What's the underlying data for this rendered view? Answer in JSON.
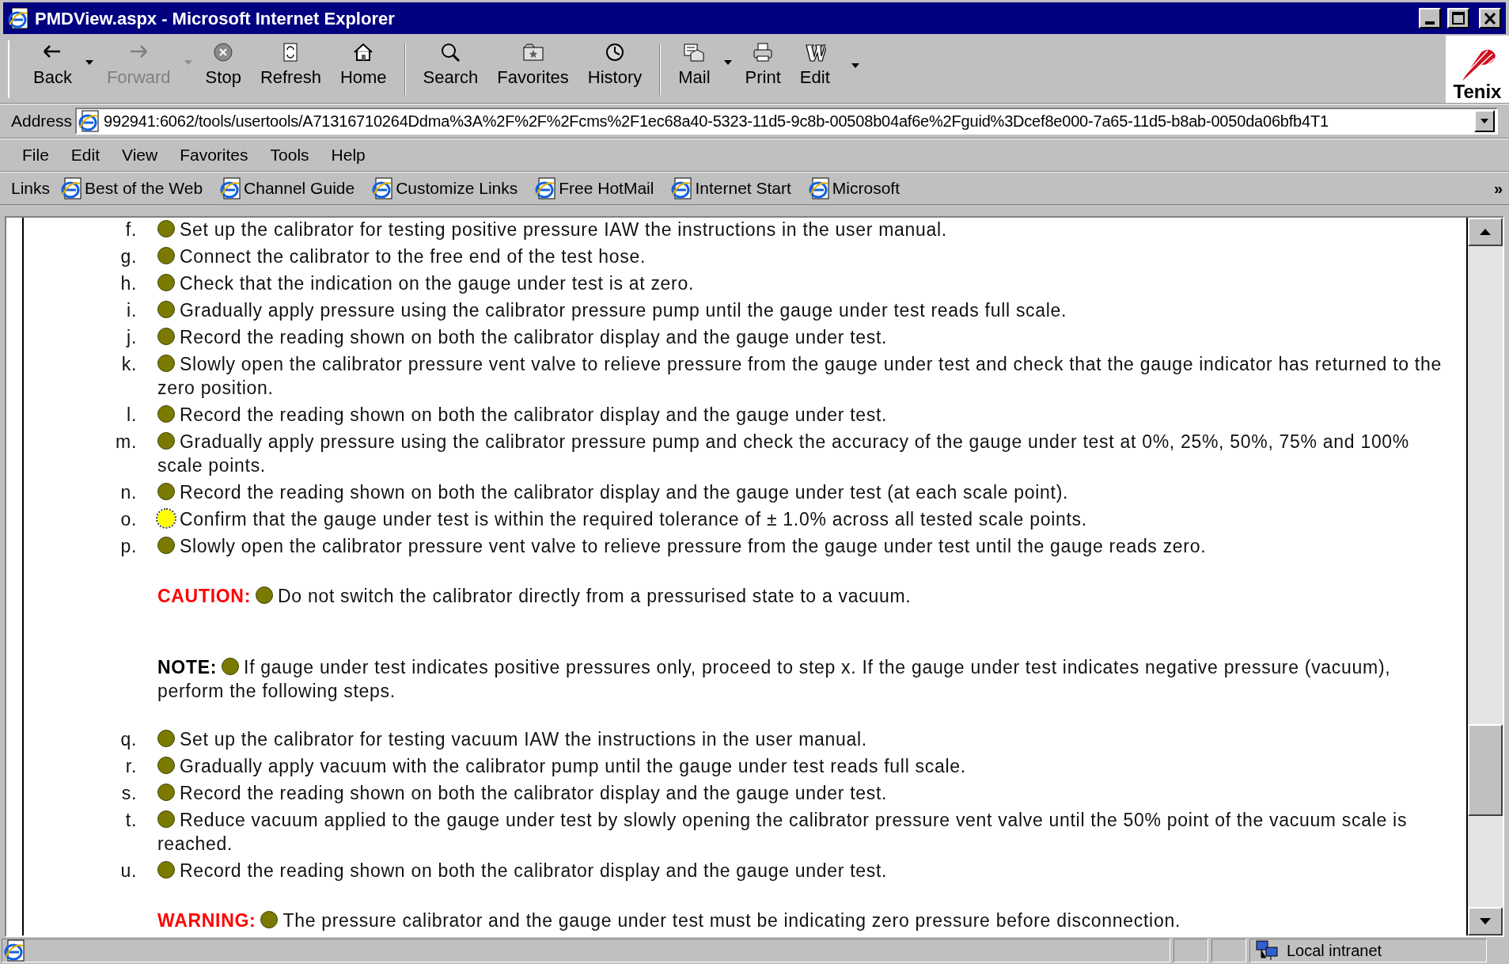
{
  "window": {
    "title": "PMDView.aspx - Microsoft Internet Explorer"
  },
  "toolbar": [
    {
      "kind": "back",
      "label": "Back",
      "disabled": false,
      "dropdown": true
    },
    {
      "kind": "forward",
      "label": "Forward",
      "disabled": true,
      "dropdown": true
    },
    {
      "kind": "stop",
      "label": "Stop",
      "disabled": false,
      "dropdown": false
    },
    {
      "kind": "refresh",
      "label": "Refresh",
      "disabled": false,
      "dropdown": false
    },
    {
      "kind": "home",
      "label": "Home",
      "disabled": false,
      "dropdown": false
    },
    {
      "kind": "separator"
    },
    {
      "kind": "search",
      "label": "Search",
      "disabled": false,
      "dropdown": false
    },
    {
      "kind": "favorites",
      "label": "Favorites",
      "disabled": false,
      "dropdown": false
    },
    {
      "kind": "history",
      "label": "History",
      "disabled": false,
      "dropdown": false
    },
    {
      "kind": "separator"
    },
    {
      "kind": "mail",
      "label": "Mail",
      "disabled": false,
      "dropdown": true
    },
    {
      "kind": "print",
      "label": "Print",
      "disabled": false,
      "dropdown": false
    },
    {
      "kind": "edit",
      "label": "Edit",
      "disabled": false,
      "dropdown": false
    },
    {
      "kind": "more"
    }
  ],
  "logo": {
    "text": "Tenix"
  },
  "address": {
    "label": "Address",
    "value": "992941:6062/tools/usertools/A71316710264Ddma%3A%2F%2F%2Fcms%2F1ec68a40-5323-11d5-9c8b-00508b04af6e%2Fguid%3Dcef8e000-7a65-11d5-b8ab-0050da06bfb4T1"
  },
  "menu": [
    "File",
    "Edit",
    "View",
    "Favorites",
    "Tools",
    "Help"
  ],
  "links": {
    "label": "Links",
    "items": [
      "Best of the Web",
      "Channel Guide",
      "Customize Links",
      "Free HotMail",
      "Internet Start",
      "Microsoft"
    ],
    "overflow": "»"
  },
  "content": [
    {
      "kind": "step",
      "label": "f.",
      "text": "Set up the calibrator for testing positive pressure IAW the instructions in the user manual.",
      "selected": false
    },
    {
      "kind": "step",
      "label": "g.",
      "text": "Connect the calibrator to the free end of the test hose.",
      "selected": false
    },
    {
      "kind": "step",
      "label": "h.",
      "text": "Check that the indication on the gauge under test is at zero.",
      "selected": false
    },
    {
      "kind": "step",
      "label": "i.",
      "text": "Gradually apply pressure using the calibrator pressure pump until the gauge under test reads full scale.",
      "selected": false
    },
    {
      "kind": "step",
      "label": "j.",
      "text": "Record the reading shown on both the calibrator display and the gauge under test.",
      "selected": false
    },
    {
      "kind": "step",
      "label": "k.",
      "text": "Slowly open the calibrator pressure vent valve to relieve pressure from the gauge under test and check that the gauge indicator has returned to the zero position.",
      "selected": false
    },
    {
      "kind": "step",
      "label": "l.",
      "text": "Record the reading shown on both the calibrator display and the gauge under test.",
      "selected": false
    },
    {
      "kind": "step",
      "label": "m.",
      "text": "Gradually apply pressure using the calibrator pressure pump and check the accuracy of the gauge under test at 0%, 25%, 50%, 75% and 100% scale points.",
      "selected": false
    },
    {
      "kind": "step",
      "label": "n.",
      "text": "Record the reading shown on both the calibrator display and the gauge under test (at each scale point).",
      "selected": false
    },
    {
      "kind": "step",
      "label": "o.",
      "text": "Confirm that the gauge under test is within the required tolerance of ± 1.0% across all tested scale points.",
      "selected": true
    },
    {
      "kind": "step",
      "label": "p.",
      "text": "Slowly open the calibrator pressure vent valve to relieve pressure from the gauge under test until the gauge reads zero.",
      "selected": false
    },
    {
      "kind": "caution",
      "label": "CAUTION:",
      "text": "Do not switch the calibrator directly from a pressurised state to a vacuum."
    },
    {
      "kind": "note",
      "label": "NOTE:",
      "text": "If gauge under test indicates positive pressures only, proceed to step x. If the gauge under test indicates negative pressure (vacuum), perform the following steps."
    },
    {
      "kind": "step",
      "label": "q.",
      "text": "Set up the calibrator for testing vacuum IAW the instructions in the user manual.",
      "selected": false
    },
    {
      "kind": "step",
      "label": "r.",
      "text": "Gradually apply vacuum with the calibrator pump until the gauge under test reads full scale.",
      "selected": false
    },
    {
      "kind": "step",
      "label": "s.",
      "text": "Record the reading shown on both the calibrator display and the gauge under test.",
      "selected": false
    },
    {
      "kind": "step",
      "label": "t.",
      "text": "Reduce vacuum applied to the gauge under test by slowly opening the calibrator pressure vent valve until the 50% point of the vacuum scale is reached.",
      "selected": false
    },
    {
      "kind": "step",
      "label": "u.",
      "text": "Record the reading shown on both the calibrator display and the gauge under test.",
      "selected": false
    },
    {
      "kind": "warning",
      "label": "WARNING:",
      "text": "The pressure calibrator and the gauge under test must be indicating zero pressure before disconnection."
    }
  ],
  "status_bar": {
    "zone": "Local intranet"
  }
}
